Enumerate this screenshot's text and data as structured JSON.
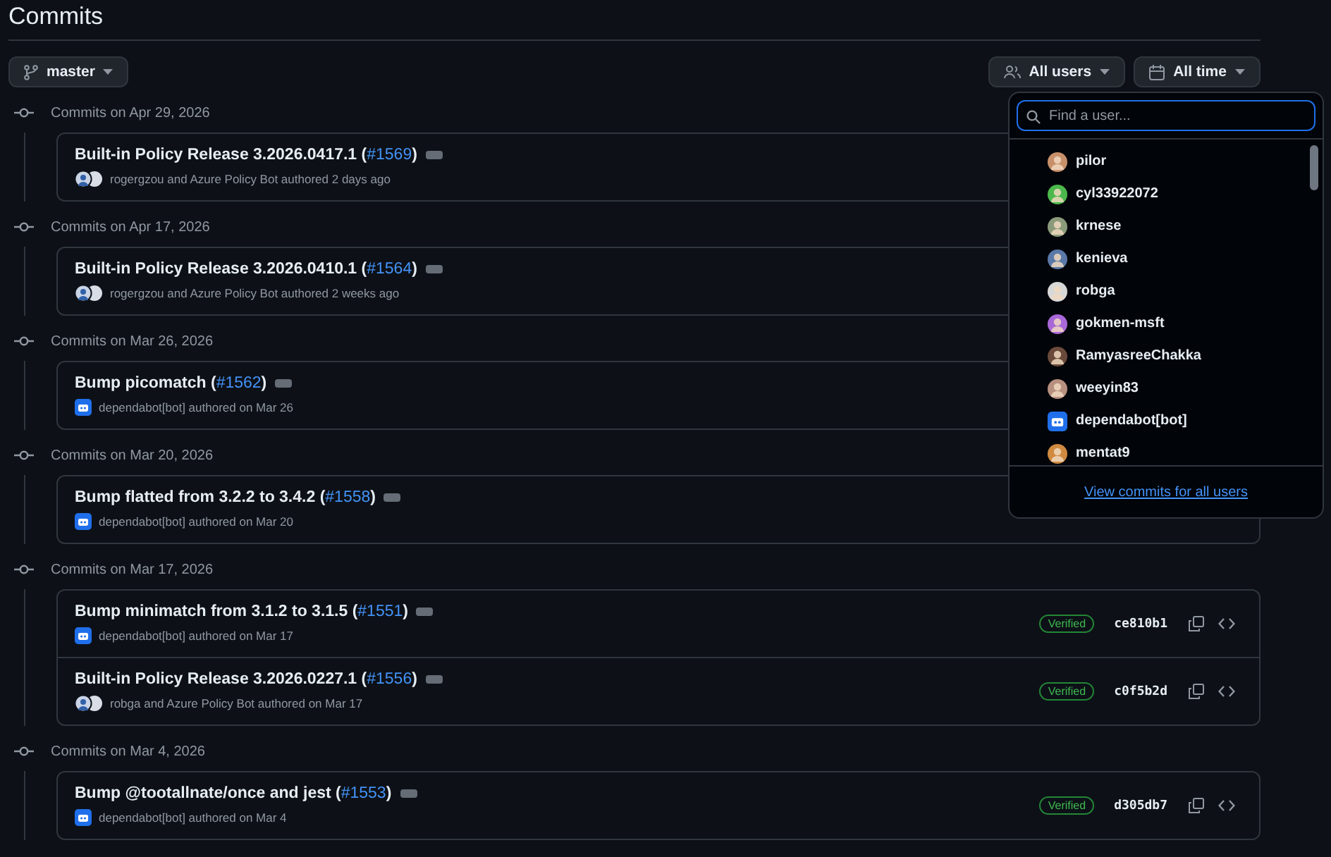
{
  "title": "Commits",
  "branch": "master",
  "filters": [
    {
      "kind": "users",
      "label": "All users"
    },
    {
      "kind": "time",
      "label": "All time"
    }
  ],
  "groups": [
    {
      "heading": "Commits on Apr 29, 2026",
      "commits": [
        {
          "title": "Built-in Policy Release 3.2026.0417.1 (",
          "pr": "#1569",
          "close": ")",
          "authors": "rogergzou and Azure Policy Bot authored 2 days ago",
          "kind": "pair"
        }
      ]
    },
    {
      "heading": "Commits on Apr 17, 2026",
      "commits": [
        {
          "title": "Built-in Policy Release 3.2026.0410.1 (",
          "pr": "#1564",
          "close": ")",
          "authors": "rogergzou and Azure Policy Bot authored 2 weeks ago",
          "kind": "pair"
        }
      ]
    },
    {
      "heading": "Commits on Mar 26, 2026",
      "commits": [
        {
          "title": "Bump picomatch (",
          "pr": "#1562",
          "close": ")",
          "authors": "dependabot[bot] authored on Mar 26",
          "kind": "bot"
        }
      ]
    },
    {
      "heading": "Commits on Mar 20, 2026",
      "commits": [
        {
          "title": "Bump flatted from 3.2.2 to 3.4.2 (",
          "pr": "#1558",
          "close": ")",
          "authors": "dependabot[bot] authored on Mar 20",
          "kind": "bot"
        }
      ]
    },
    {
      "heading": "Commits on Mar 17, 2026",
      "commits": [
        {
          "title": "Bump minimatch from 3.1.2 to 3.1.5 (",
          "pr": "#1551",
          "close": ")",
          "authors": "dependabot[bot] authored on Mar 17",
          "kind": "bot",
          "badge": "Verified",
          "hash": "ce810b1"
        },
        {
          "title": "Built-in Policy Release 3.2026.0227.1 (",
          "pr": "#1556",
          "close": ")",
          "authors": "robga and Azure Policy Bot authored on Mar 17",
          "kind": "pair",
          "badge": "Verified",
          "hash": "c0f5b2d"
        }
      ]
    },
    {
      "heading": "Commits on Mar 4, 2026",
      "commits": [
        {
          "title": "Bump @tootallnate/once and jest (",
          "pr": "#1553",
          "close": ")",
          "authors": "dependabot[bot] authored on Mar 4",
          "kind": "bot",
          "badge": "Verified",
          "hash": "d305db7"
        }
      ]
    }
  ],
  "user_menu": {
    "placeholder": "Find a user...",
    "footer_link": "View commits for all users",
    "users": [
      {
        "name": "pilor",
        "kind": "person",
        "color": "#c8906a"
      },
      {
        "name": "cyl33922072",
        "kind": "person",
        "color": "#4cb84c"
      },
      {
        "name": "krnese",
        "kind": "person",
        "color": "#8a9a7a"
      },
      {
        "name": "kenieva",
        "kind": "person",
        "color": "#5a78a8"
      },
      {
        "name": "robga",
        "kind": "person",
        "color": "#d8d8d8"
      },
      {
        "name": "gokmen-msft",
        "kind": "person",
        "color": "#a968d8"
      },
      {
        "name": "RamyasreeChakka",
        "kind": "person",
        "color": "#6a4a3a"
      },
      {
        "name": "weeyin83",
        "kind": "person",
        "color": "#b89080"
      },
      {
        "name": "dependabot[bot]",
        "kind": "bot",
        "color": "#1f6feb"
      },
      {
        "name": "mentat9",
        "kind": "person",
        "color": "#d08a40"
      }
    ]
  }
}
